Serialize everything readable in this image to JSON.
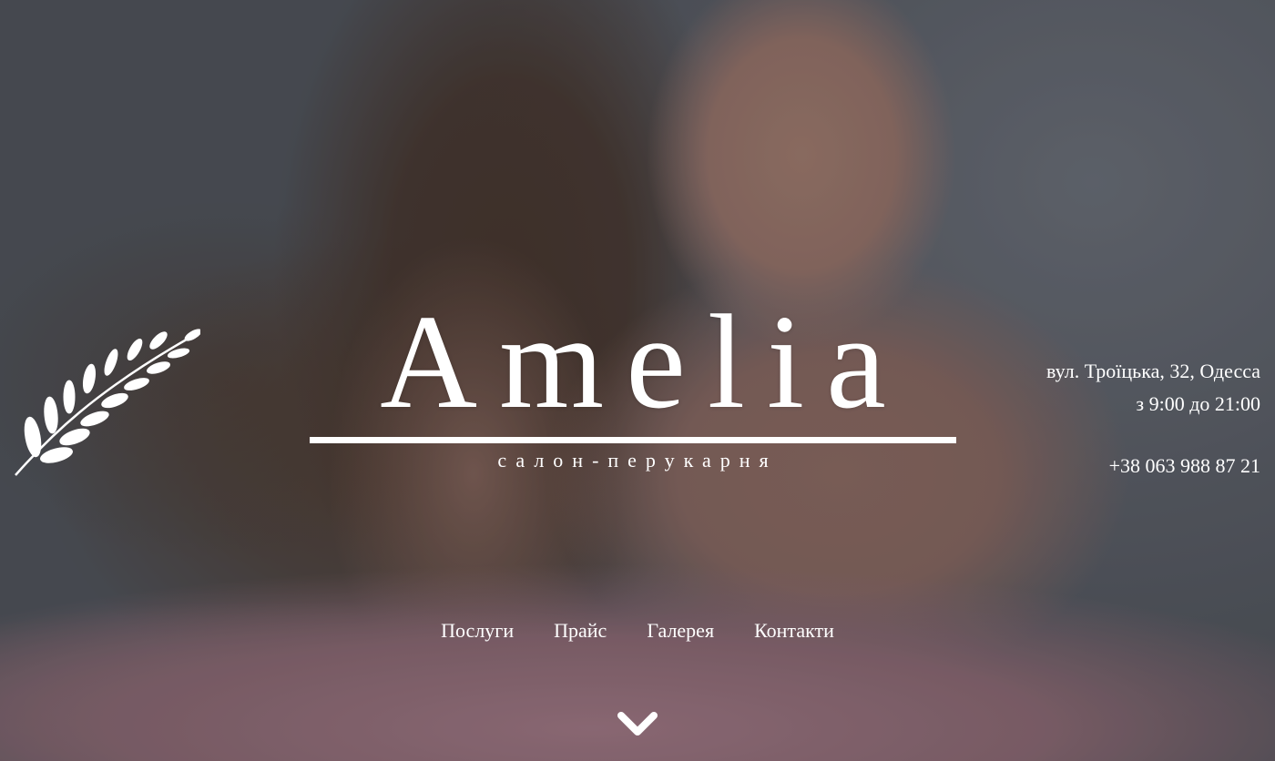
{
  "brand": {
    "name": "Amelia",
    "tagline": "салон-перукарня"
  },
  "contacts": {
    "address": "вул. Троїцька, 32, Одесса",
    "hours": "з 9:00 до 21:00",
    "phone": "+38 063 988 87 21"
  },
  "nav": {
    "items": [
      {
        "label": "Послуги"
      },
      {
        "label": "Прайс"
      },
      {
        "label": "Галерея"
      },
      {
        "label": "Контакти"
      }
    ]
  },
  "icons": {
    "logo": "leaf-icon",
    "scroll": "chevron-down-icon"
  },
  "colors": {
    "text": "#ffffff",
    "background": "#565a61"
  }
}
